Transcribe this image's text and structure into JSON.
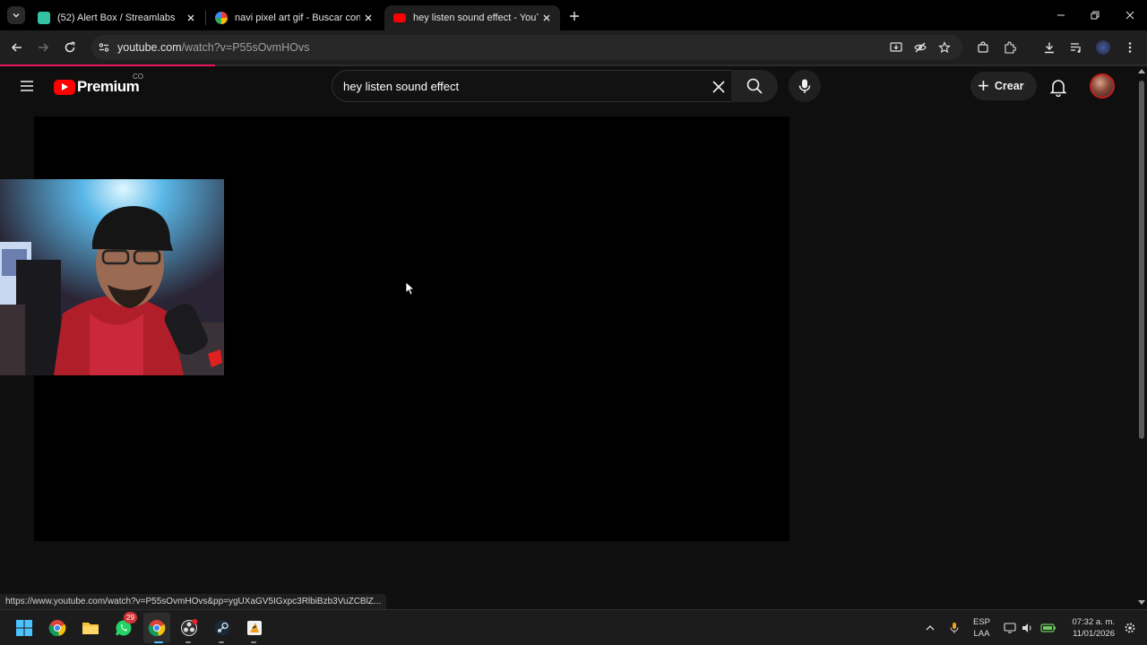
{
  "browser": {
    "tabs": [
      {
        "title": "(52) Alert Box / Streamlabs",
        "active": false
      },
      {
        "title": "navi pixel art gif - Buscar con G",
        "active": false
      },
      {
        "title": "hey listen sound effect - YouTu",
        "active": true
      }
    ],
    "url_host": "youtube.com",
    "url_path": "/watch?v=P55sOvmHOvs",
    "status_url": "https://www.youtube.com/watch?v=P55sOvmHOvs&pp=ygUXaGV5IGxpc3RlbiBzb3VuZCBlZ..."
  },
  "youtube": {
    "logo_text": "Premium",
    "country_code": "CO",
    "search_query": "hey listen sound effect",
    "create_label": "Crear"
  },
  "taskbar": {
    "whatsapp_badge": "29",
    "lang_line1": "ESP",
    "lang_line2": "LAA",
    "time": "07:32 a. m.",
    "date": "11/01/2026"
  },
  "colors": {
    "accent_red": "#ff0000",
    "loading_bar": "#e8175d",
    "page_bg": "#0f0f0f"
  }
}
